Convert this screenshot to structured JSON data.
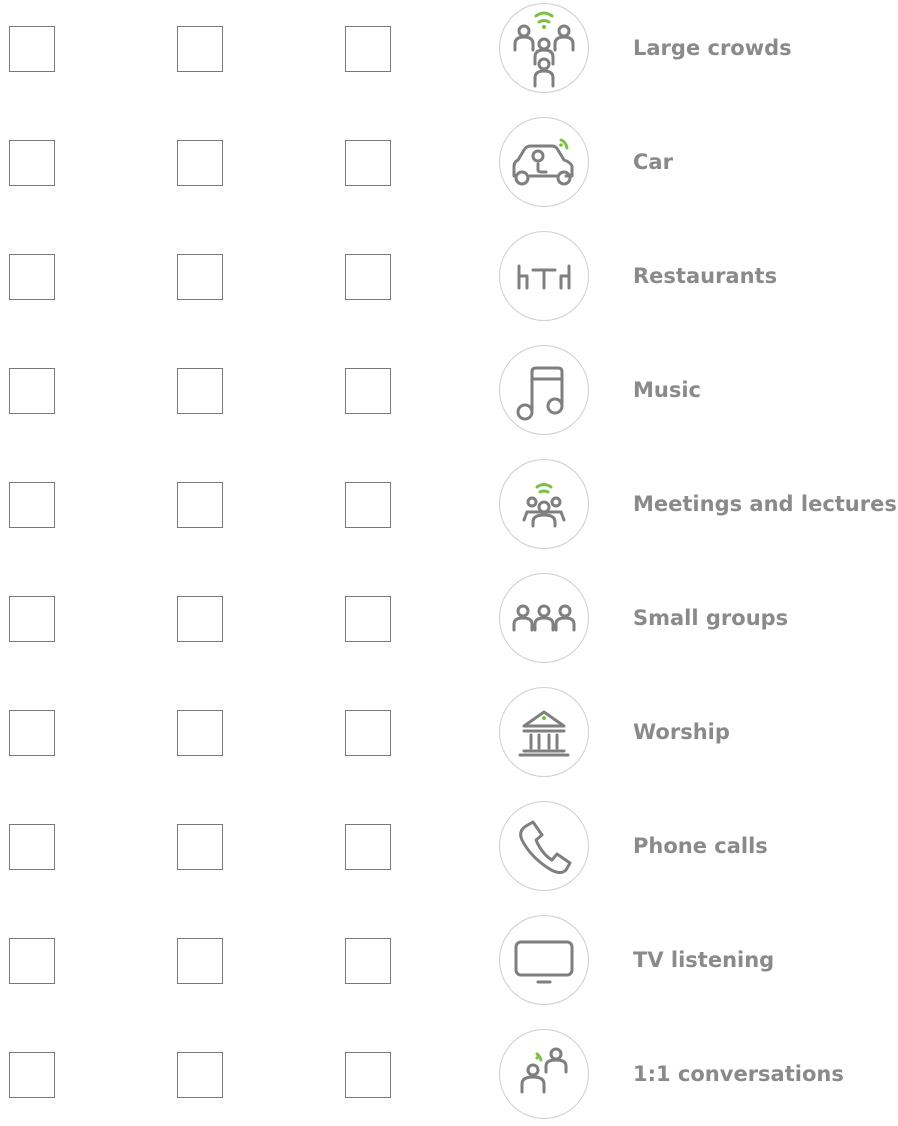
{
  "colors": {
    "icon_gray": "#7f7f7f",
    "accent_green": "#7ac143",
    "label_gray": "#8a8a8a",
    "checkbox_border": "#7a7a7a"
  },
  "rows": [
    {
      "label": "Large crowds",
      "icon": "large-crowds-icon"
    },
    {
      "label": "Car",
      "icon": "car-icon"
    },
    {
      "label": "Restaurants",
      "icon": "restaurant-icon"
    },
    {
      "label": "Music",
      "icon": "music-note-icon"
    },
    {
      "label": "Meetings and lectures",
      "icon": "meetings-icon"
    },
    {
      "label": "Small groups",
      "icon": "small-groups-icon"
    },
    {
      "label": "Worship",
      "icon": "worship-building-icon"
    },
    {
      "label": "Phone calls",
      "icon": "phone-icon"
    },
    {
      "label": "TV listening",
      "icon": "tv-icon"
    },
    {
      "label": "1:1 conversations",
      "icon": "conversation-icon"
    }
  ]
}
